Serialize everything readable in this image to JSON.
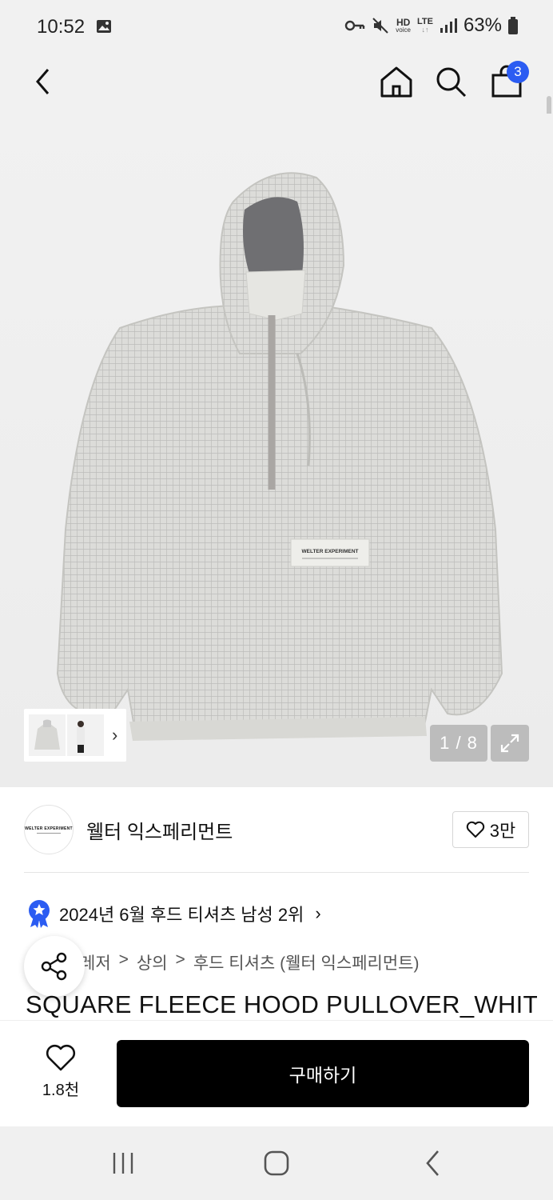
{
  "status_bar": {
    "time": "10:52",
    "hd_label": "HD",
    "voice_label": "voice",
    "lte_label": "LTE",
    "battery_percent": "63%"
  },
  "header": {
    "cart_count": "3"
  },
  "gallery": {
    "counter": "1 / 8",
    "label_text": "WELTER EXPERIMENT"
  },
  "brand": {
    "logo_text": "WELTER EXPERIMENT",
    "name": "웰터 익스페리먼트",
    "like_count": "3만"
  },
  "ranking": {
    "text": "2024년 6월 후드 티셔츠 남성 2위",
    "badge_color": "#2b5cf2"
  },
  "breadcrumb": {
    "items": [
      "레저",
      ">",
      "상의",
      ">",
      "후드 티셔츠 (웰터 익스페리먼트)"
    ]
  },
  "product": {
    "title": "SQUARE FLEECE HOOD PULLOVER_WHITE"
  },
  "bottom_bar": {
    "like_count": "1.8천",
    "buy_label": "구매하기"
  }
}
